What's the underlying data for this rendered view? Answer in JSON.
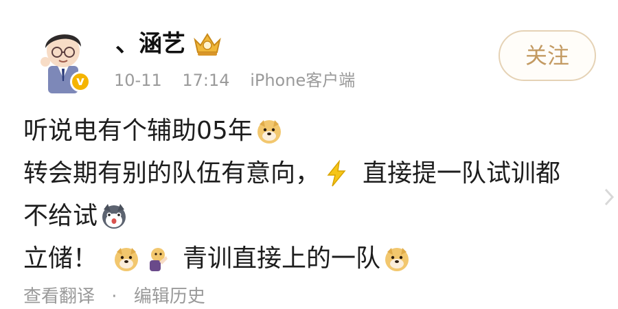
{
  "post": {
    "author": {
      "name": "、涵艺",
      "avatar_icon": "cartoon-avatar-icon",
      "verified_icon": "verified-v-icon",
      "verified_mark": "v",
      "member_icon": "crown-badge-icon"
    },
    "meta": {
      "date": "10-11",
      "time": "17:14",
      "client": "iPhone客户端"
    },
    "follow_label": "关注",
    "content": {
      "line1_text": "听说电有个辅助05年",
      "line1_emoji": "doge-emoji-icon",
      "line2_text_a": "转会期有别的队伍有意向，",
      "line2_emoji": "lightning-emoji-icon",
      "line2_text_b": "直接提一队试训都",
      "line3_text": "不给试",
      "line3_emoji": "husky-emoji-icon",
      "line4_text_a": "立储！",
      "line4_emoji_a": "doge-emoji-icon",
      "line4_emoji_b": "thinking-emoji-icon",
      "line4_text_b": "青训直接上的一队",
      "line4_emoji_c": "doge-emoji-icon"
    },
    "footer": {
      "translate_label": "查看翻译",
      "separator": "·",
      "history_label": "编辑历史"
    }
  },
  "colors": {
    "follow_text": "#c39a62",
    "follow_border": "#e5d2b5",
    "meta_gray": "#9a9a9a",
    "verified_yellow": "#f5b400",
    "text_dark": "#1d1d1d"
  }
}
